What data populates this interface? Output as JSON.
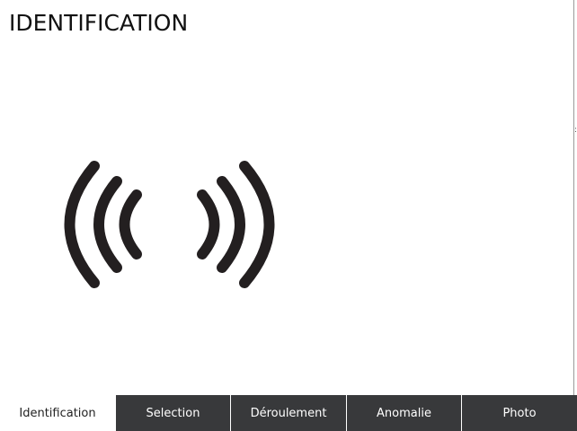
{
  "page": {
    "title": "IDENTIFICATION"
  },
  "nfc_graphic": {
    "icon": "nfc-signal-icon",
    "color": "#231f20"
  },
  "tabs": [
    {
      "label": "Identification",
      "active": true
    },
    {
      "label": "Selection",
      "active": false
    },
    {
      "label": "Déroulement",
      "active": false
    },
    {
      "label": "Anomalie",
      "active": false
    },
    {
      "label": "Photo",
      "active": false
    }
  ],
  "colors": {
    "tab_background": "#38393b",
    "tab_active_background": "#ffffff",
    "tab_text": "#ffffff",
    "tab_active_text": "#222222"
  }
}
